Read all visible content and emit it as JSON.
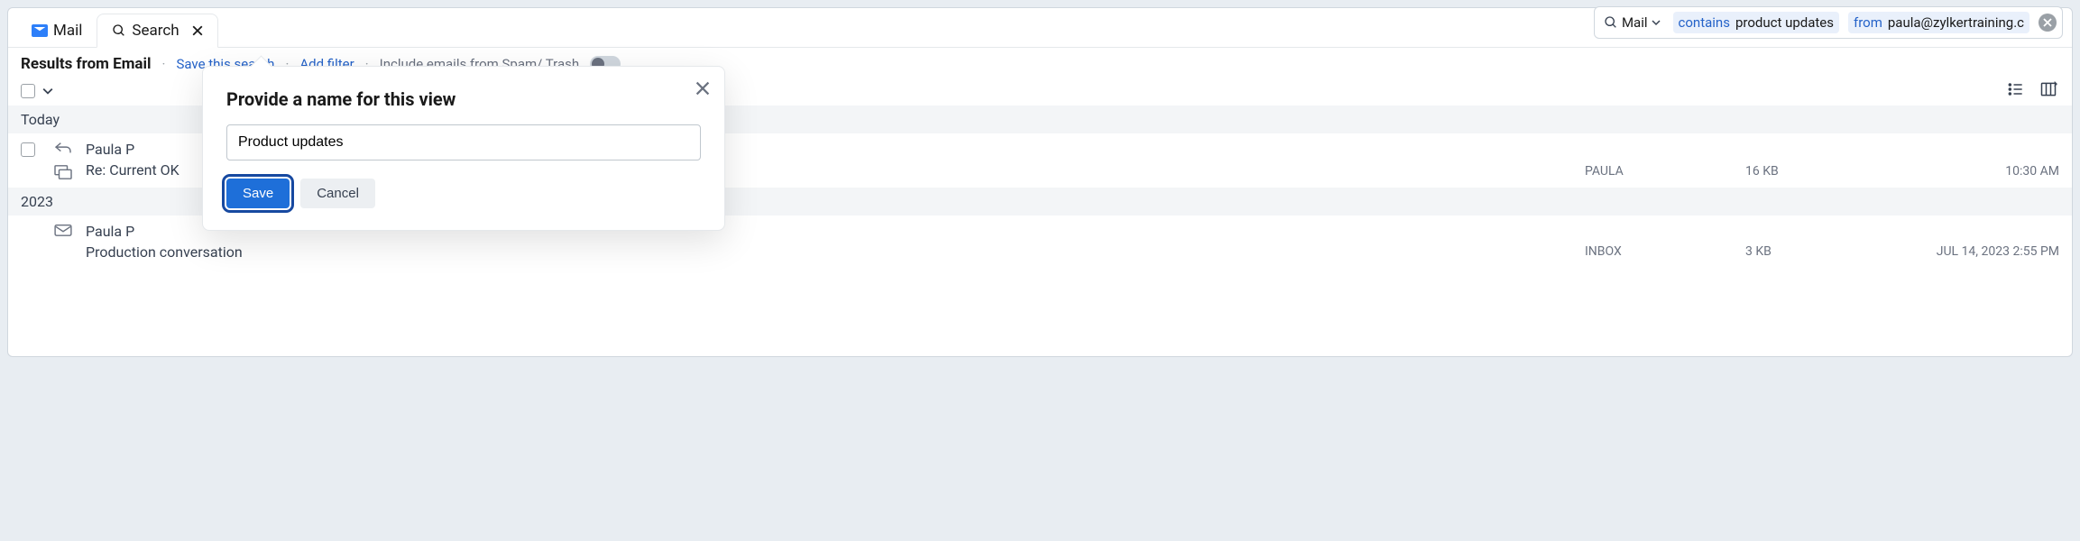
{
  "search_bar": {
    "scope_label": "Mail",
    "chips": [
      {
        "key": "contains",
        "val": "product updates"
      },
      {
        "key": "from",
        "val": "paula@zylkertraining.c"
      }
    ]
  },
  "tabs": {
    "mail_label": "Mail",
    "search_label": "Search"
  },
  "toolbar": {
    "title": "Results from Email",
    "save_search": "Save this search",
    "add_filter": "Add filter",
    "spam_trash": "Include emails from Spam/ Trash"
  },
  "groups": [
    {
      "label": "Today",
      "emails": [
        {
          "sender": "Paula P",
          "subject": "Re: Current OK",
          "folder": "PAULA",
          "size": "16 KB",
          "time": "10:30 AM",
          "has_reply": true
        }
      ]
    },
    {
      "label": "2023",
      "emails": [
        {
          "sender": "Paula P",
          "subject": "Production conversation",
          "folder": "INBOX",
          "size": "3 KB",
          "time": "JUL 14, 2023 2:55 PM",
          "has_reply": false
        }
      ]
    }
  ],
  "modal": {
    "title": "Provide a name for this view",
    "input_value": "Product updates",
    "save_label": "Save",
    "cancel_label": "Cancel"
  }
}
